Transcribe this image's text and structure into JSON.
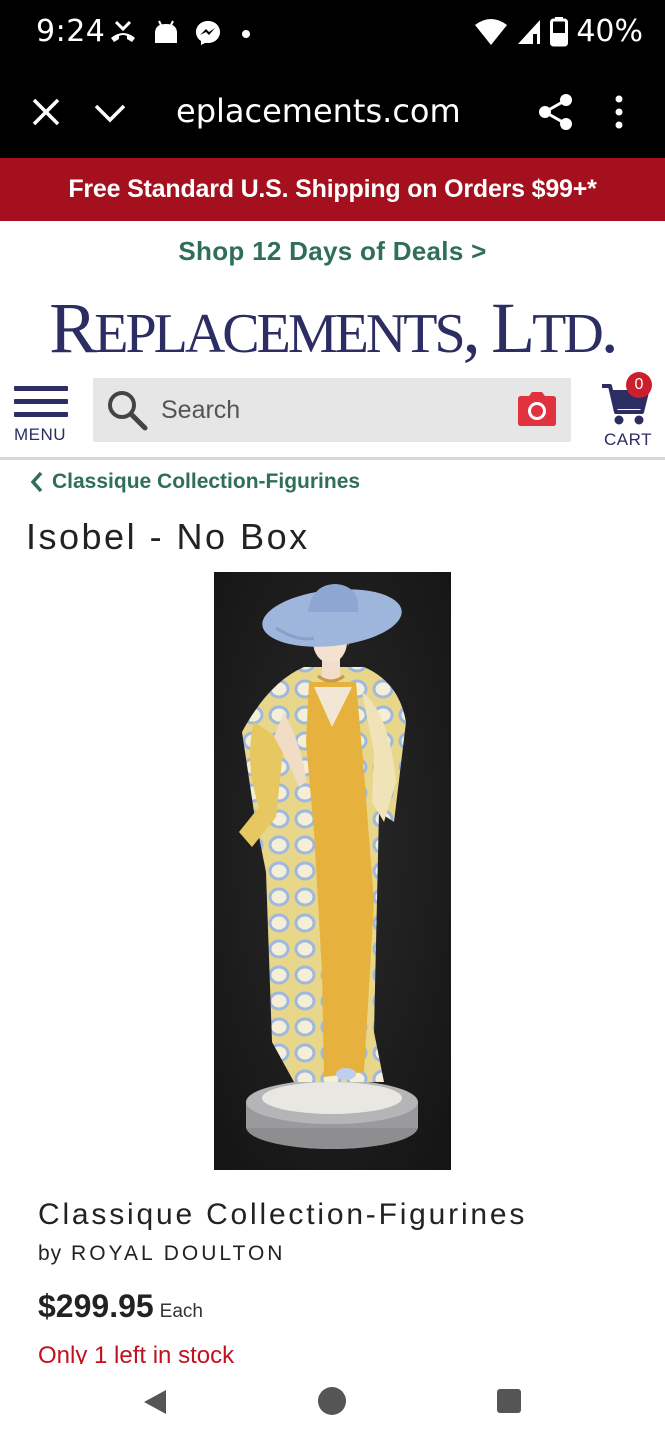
{
  "status_bar": {
    "time": "9:24",
    "battery": "40%",
    "icons": [
      "missed-call-icon",
      "android-icon",
      "messenger-icon",
      "dot-icon",
      "wifi-icon",
      "signal-icon",
      "battery-icon"
    ]
  },
  "browser": {
    "url": "eplacements.com",
    "buttons": [
      "close-icon",
      "chevron-down-icon",
      "share-icon",
      "more-icon"
    ]
  },
  "shipping_banner": "Free Standard U.S. Shipping on Orders $99+*",
  "deals_link": "Shop 12 Days of Deals >",
  "logo": {
    "r": "R",
    "eplacements": "EPLACEMENTS",
    "comma": ",",
    "l": "L",
    "td": "TD",
    "dot": "."
  },
  "header": {
    "menu_label": "MENU",
    "search_placeholder": "Search",
    "cart_label": "CART",
    "cart_count": "0"
  },
  "breadcrumb": "Classique Collection-Figurines",
  "product": {
    "title": "Isobel - No Box",
    "collection": "Classique Collection-Figurines",
    "by": "by",
    "brand": "ROYAL DOULTON",
    "price": "$299.95",
    "price_unit": "Each",
    "stock": "Only 1 left in stock"
  },
  "colors": {
    "banner": "#a4101d",
    "brand_navy": "#2b2d63",
    "link_green": "#2f6e5c",
    "stock_red": "#c0111f"
  }
}
